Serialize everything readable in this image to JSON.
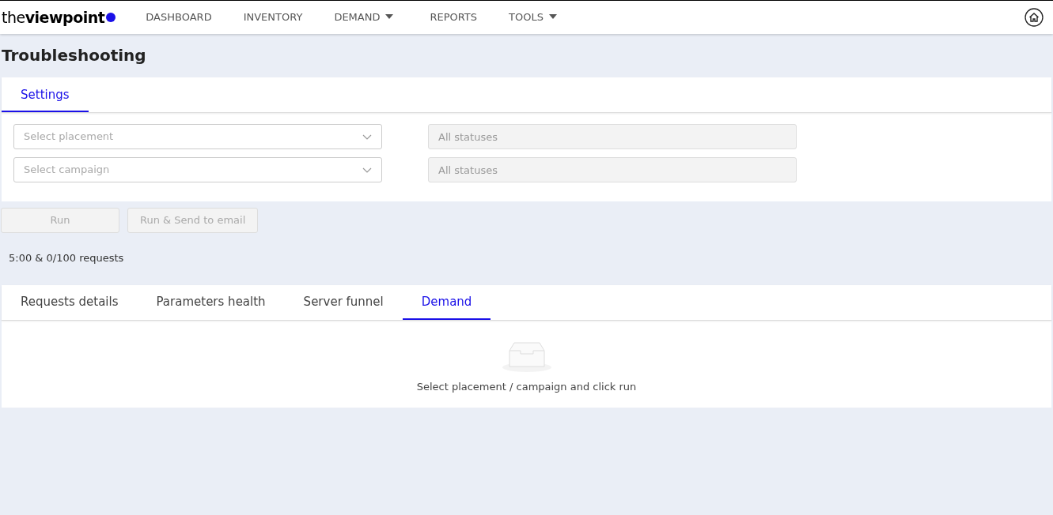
{
  "navbar": {
    "logo": "the**viewpoint**",
    "items": [
      {
        "label": "DASHBOARD",
        "dropdown": false
      },
      {
        "label": "INVENTORY",
        "dropdown": false
      },
      {
        "label": "DEMAND",
        "dropdown": true
      },
      {
        "label": "REPORTS",
        "dropdown": false
      },
      {
        "label": "TOOLS",
        "dropdown": true
      }
    ]
  },
  "page_title": "Troubleshooting",
  "settings": {
    "tabs": [
      {
        "label": "Settings",
        "selected": true
      }
    ],
    "filters": [
      {
        "placeholder": "Select placement",
        "status_placeholder": "All statuses",
        "status_disabled": true
      },
      {
        "placeholder": "Select campaign",
        "status_placeholder": "All statuses",
        "status_disabled": true
      }
    ]
  },
  "buttons": [
    {
      "label": "Run",
      "disabled": true
    },
    {
      "label": "Run & Send to email",
      "disabled": true
    }
  ],
  "quota": "5:00 & 0/100 requests",
  "result_tabs": [
    {
      "label": "Requests details",
      "selected": false
    },
    {
      "label": "Parameters health",
      "selected": false
    },
    {
      "label": "Server funnel",
      "selected": false
    },
    {
      "label": "Demand",
      "selected": true
    }
  ],
  "empty_message": "Select placement / campaign and click run"
}
